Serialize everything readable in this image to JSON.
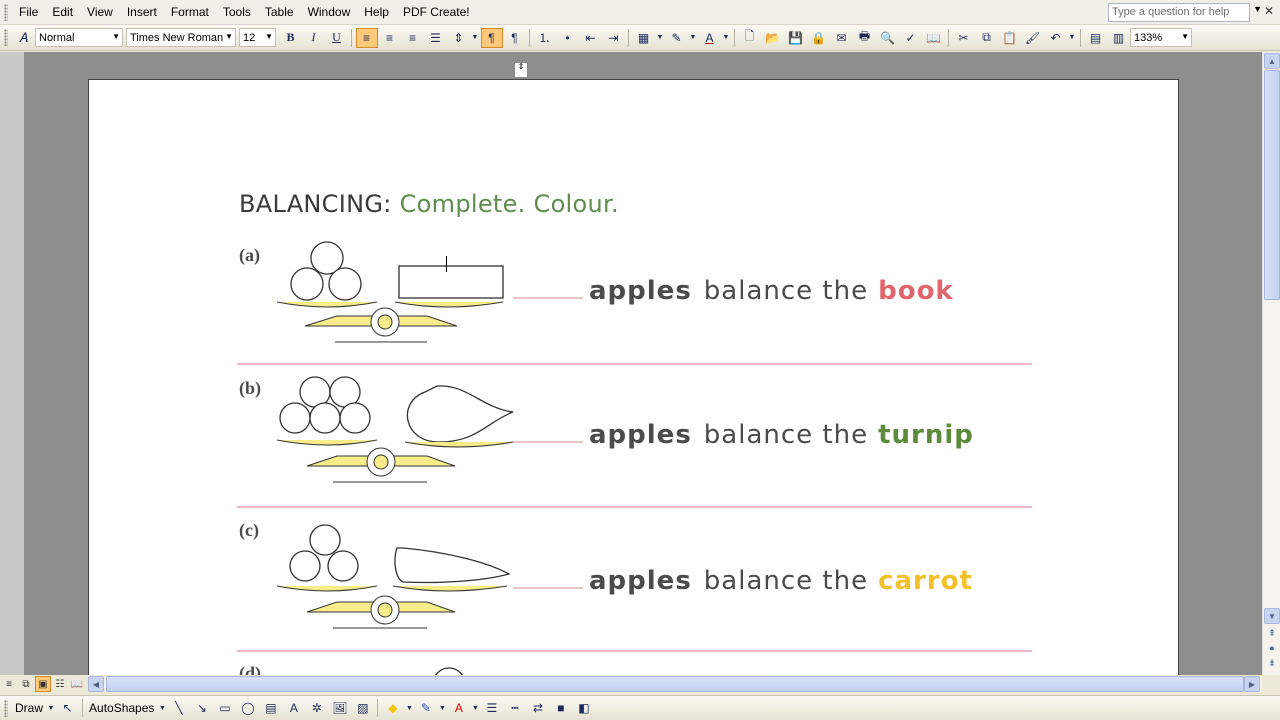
{
  "menubar": {
    "items": [
      "File",
      "Edit",
      "View",
      "Insert",
      "Format",
      "Tools",
      "Table",
      "Window",
      "Help",
      "PDF Create!"
    ],
    "help_placeholder": "Type a question for help"
  },
  "toolbar": {
    "style": "Normal",
    "font": "Times New Roman",
    "size": "12",
    "bold": "B",
    "italic": "I",
    "underline": "U",
    "zoom": "133%"
  },
  "worksheet": {
    "heading_prefix": "BALANCING:",
    "heading_suffix": "Complete. Colour.",
    "items": [
      {
        "label": "(a)",
        "word": "apples",
        "rest": "balance the",
        "object": "book",
        "object_color": "#e0666e"
      },
      {
        "label": "(b)",
        "word": "apples",
        "rest": "balance the",
        "object": "turnip",
        "object_color": "#5c8c3a"
      },
      {
        "label": "(c)",
        "word": "apples",
        "rest": "balance the",
        "object": "carrot",
        "object_color": "#f2c02a"
      },
      {
        "label": "(d)"
      }
    ]
  },
  "drawbar": {
    "draw": "Draw",
    "autoshapes": "AutoShapes"
  }
}
